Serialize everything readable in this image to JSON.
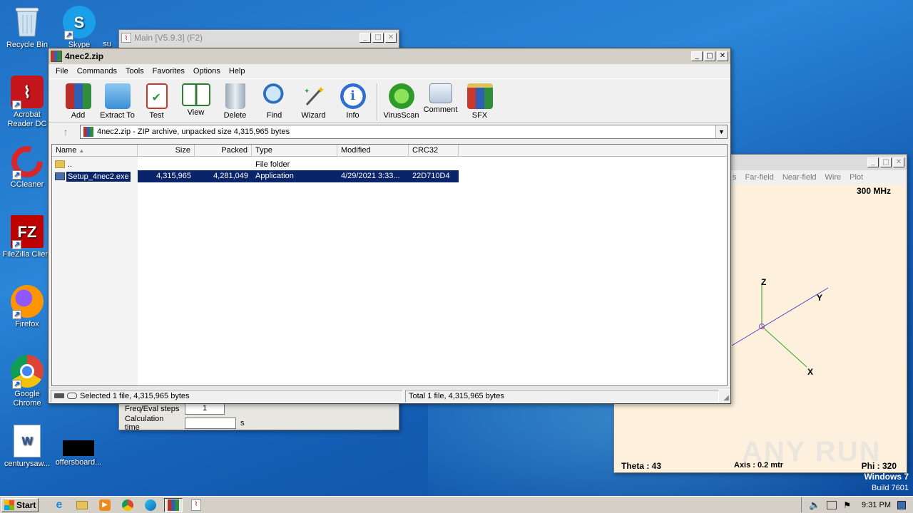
{
  "desktop": {
    "icons": [
      {
        "label": "Recycle Bin"
      },
      {
        "label": "Skype"
      },
      {
        "label": "su"
      },
      {
        "label": "Acrobat Reader DC"
      },
      {
        "label": "CCleaner"
      },
      {
        "label": "FileZilla Client"
      },
      {
        "label": "Firefox"
      },
      {
        "label": "Google Chrome"
      },
      {
        "label": "centurysaw..."
      },
      {
        "label": "offersboard..."
      }
    ],
    "watermark": "ANY RUN",
    "os_label": "Windows 7",
    "build_label": "Build 7601"
  },
  "nec_main": {
    "title": "Main [V5.9.3]  (F2)",
    "freq_label": "Freq/Eval steps",
    "freq_value": "1",
    "calc_label": "Calculation time",
    "calc_value": "",
    "calc_unit": "s"
  },
  "geometry_window": {
    "menu": [
      "s",
      "Far-field",
      "Near-field",
      "Wire",
      "Plot"
    ],
    "frequency": "300 MHz",
    "axis_z": "Z",
    "axis_y": "Y",
    "axis_x": "X",
    "theta": "Theta : 43",
    "axis_info": "Axis : 0.2 mtr",
    "phi": "Phi : 320"
  },
  "winrar": {
    "title": "4nec2.zip",
    "menu": [
      "File",
      "Commands",
      "Tools",
      "Favorites",
      "Options",
      "Help"
    ],
    "tools": [
      {
        "label": "Add",
        "icon": "add-archive-icon"
      },
      {
        "label": "Extract To",
        "icon": "extract-folder-icon"
      },
      {
        "label": "Test",
        "icon": "test-clipboard-icon"
      },
      {
        "label": "View",
        "icon": "view-book-icon"
      },
      {
        "label": "Delete",
        "icon": "trash-icon"
      },
      {
        "label": "Find",
        "icon": "magnifier-icon"
      },
      {
        "label": "Wizard",
        "icon": "wand-icon"
      },
      {
        "label": "Info",
        "icon": "info-icon"
      },
      {
        "label": "VirusScan",
        "icon": "bug-icon"
      },
      {
        "label": "Comment",
        "icon": "comment-icon"
      },
      {
        "label": "SFX",
        "icon": "sfx-books-icon"
      }
    ],
    "address": "4nec2.zip - ZIP archive, unpacked size 4,315,965 bytes",
    "columns": [
      "Name",
      "Size",
      "Packed",
      "Type",
      "Modified",
      "CRC32"
    ],
    "rows": [
      {
        "name": "..",
        "size": "",
        "packed": "",
        "type": "File folder",
        "modified": "",
        "crc": ""
      },
      {
        "name": "Setup_4nec2.exe",
        "size": "4,315,965",
        "packed": "4,281,049",
        "type": "Application",
        "modified": "4/29/2021 3:33...",
        "crc": "22D710D4"
      }
    ],
    "status_left": "Selected 1 file, 4,315,965 bytes",
    "status_right": "Total 1 file, 4,315,965 bytes"
  },
  "taskbar": {
    "start_label": "Start",
    "clock": "9:31 PM"
  }
}
